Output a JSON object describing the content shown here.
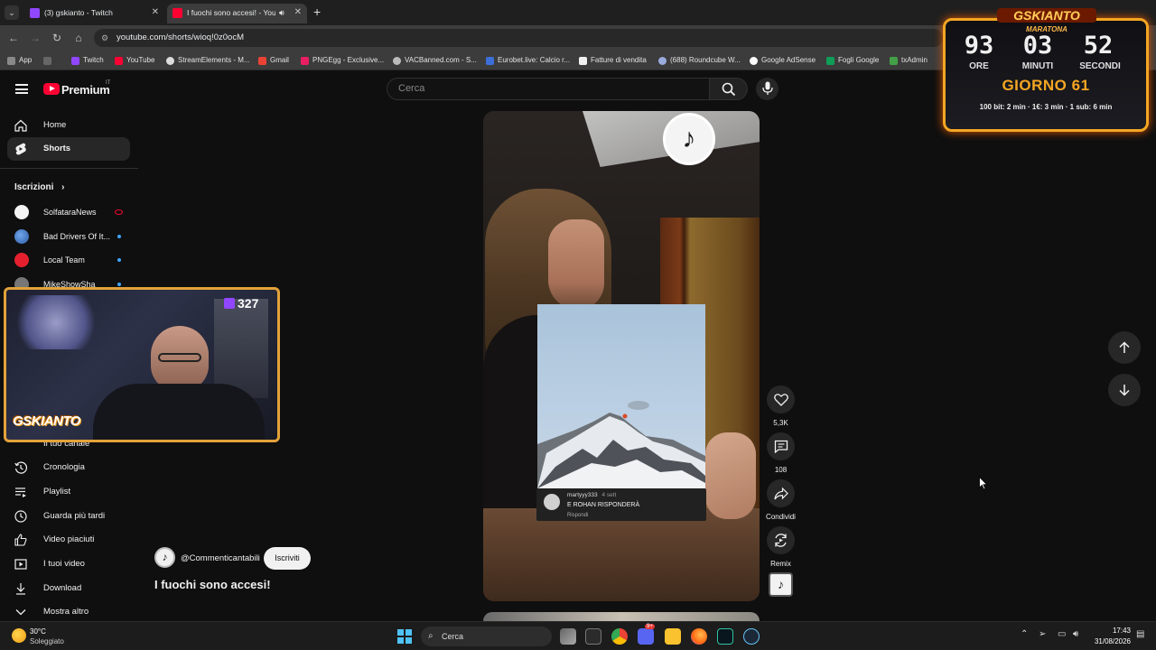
{
  "browser": {
    "tabs": [
      {
        "title": "(3) gskianto - Twitch",
        "active": false
      },
      {
        "title": "I fuochi sono accesi! - YouTube",
        "active": true
      }
    ],
    "new_tab": "+",
    "url": "youtube.com/shorts/wioq!0z0ocM",
    "bookmarks": [
      "App",
      "Twitch",
      "YouTube",
      "StreamElements - M...",
      "Gmail",
      "PNGEgg - Exclusive...",
      "VACBanned.com - S...",
      "Eurobet.live: Calcio r...",
      "Fatture di vendita",
      "(688) Roundcube W...",
      "Google AdSense",
      "Fogli Google",
      "txAdmin"
    ]
  },
  "youtube": {
    "logo": "Premium",
    "country": "IT",
    "search_placeholder": "Cerca",
    "nav": [
      {
        "label": "Home",
        "icon": "home-icon"
      },
      {
        "label": "Shorts",
        "icon": "shorts-icon",
        "active": true
      }
    ],
    "subscriptions_title": "Iscrizioni",
    "subscriptions": [
      {
        "name": "SolfataraNews",
        "status": "live"
      },
      {
        "name": "Bad Drivers Of It...",
        "status": "new"
      },
      {
        "name": "Local Team",
        "status": "new"
      },
      {
        "name": "MikeShowSha",
        "status": "new"
      }
    ],
    "you_items": [
      {
        "label": "Il tuo canale",
        "icon": "channel-icon"
      },
      {
        "label": "Cronologia",
        "icon": "history-icon"
      },
      {
        "label": "Playlist",
        "icon": "playlist-icon"
      },
      {
        "label": "Guarda più tardi",
        "icon": "watch-later-icon"
      },
      {
        "label": "Video piaciuti",
        "icon": "like-icon"
      },
      {
        "label": "I tuoi video",
        "icon": "your-videos-icon"
      },
      {
        "label": "Download",
        "icon": "download-icon"
      },
      {
        "label": "Mostra altro",
        "icon": "chevron-down-icon"
      }
    ],
    "short": {
      "channel": "@Commenticantabili",
      "subscribe_label": "Iscriviti",
      "title": "I fuochi sono accesi!",
      "comment": {
        "user": "martyyy333",
        "time": "4 sett",
        "text": "E ROHAN RISPONDERÀ",
        "reply": "Rispondi"
      },
      "likes": "5,3K",
      "comments": "108",
      "share_label": "Condividi",
      "remix_label": "Remix"
    }
  },
  "overlay": {
    "brand": "GSKIANTO",
    "subtitle": "MARATONA",
    "hours": "93",
    "minutes": "03",
    "seconds": "52",
    "hours_label": "ORE",
    "minutes_label": "MINUTI",
    "seconds_label": "SECONDI",
    "day": "GIORNO 61",
    "rates": "100 bit: 2 min · 1€: 3 min · 1 sub: 6 min",
    "viewers": "327",
    "cam_brand": "GSKIANTO"
  },
  "taskbar": {
    "temperature": "30°C",
    "weather": "Soleggiato",
    "search": "Cerca",
    "badge": "9+",
    "time": "17:43",
    "date": "31/08/2026"
  },
  "colors": {
    "youtube_red": "#ff0033",
    "overlay_orange": "#f5a623",
    "link_blue": "#3ea6ff"
  }
}
